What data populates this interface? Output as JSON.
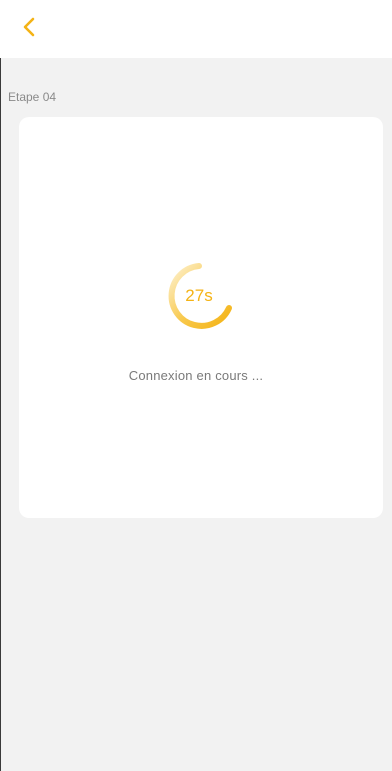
{
  "header": {
    "back_icon": "chevron-left-icon",
    "accent_color": "#f4b315"
  },
  "step": {
    "label": "Etape 04"
  },
  "loader": {
    "timer": "27s",
    "status": "Connexion en cours ..."
  }
}
